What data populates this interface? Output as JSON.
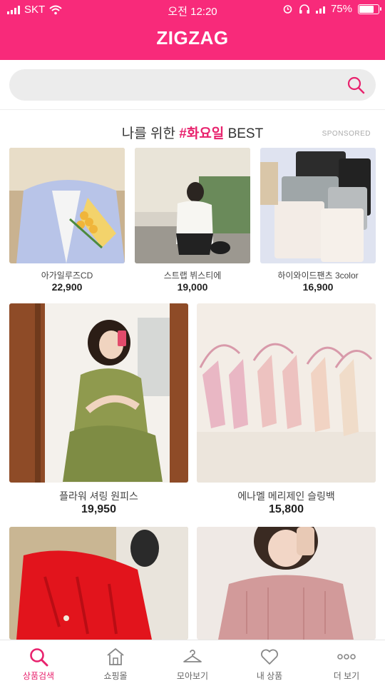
{
  "status_bar": {
    "carrier": "SKT",
    "time": "오전 12:20",
    "battery": "75%",
    "battery_level": 0.75
  },
  "header": {
    "logo": "ZIGZAG",
    "brand_color": "#f82a7a"
  },
  "search": {
    "placeholder": ""
  },
  "section": {
    "title_prefix": "나를 위한",
    "title_accent": "#화요일",
    "title_suffix": "BEST",
    "sponsored": "SPONSORED",
    "accent_color": "#e8226d"
  },
  "products_row1": [
    {
      "name": "아가일루즈CD",
      "price": "22,900"
    },
    {
      "name": "스트랩 뷔스티에",
      "price": "19,000"
    },
    {
      "name": "하이와이드팬츠 3color",
      "price": "16,900"
    }
  ],
  "products_row2": [
    {
      "name": "플라워 셔링 원피스",
      "price": "19,950"
    },
    {
      "name": "에나멜 메리제인 슬링백",
      "price": "15,800"
    }
  ],
  "tabs": [
    {
      "label": "상품검색",
      "icon": "search-icon",
      "active": true
    },
    {
      "label": "쇼핑몰",
      "icon": "shop-icon",
      "active": false
    },
    {
      "label": "모아보기",
      "icon": "hanger-icon",
      "active": false
    },
    {
      "label": "내 상품",
      "icon": "heart-icon",
      "active": false
    },
    {
      "label": "더 보기",
      "icon": "more-icon",
      "active": false
    }
  ]
}
